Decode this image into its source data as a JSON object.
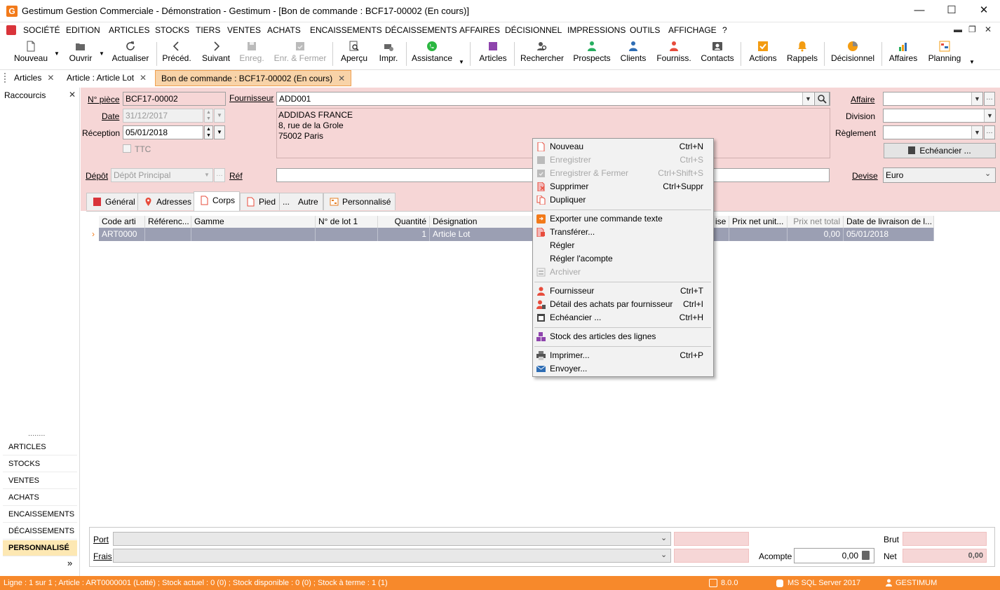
{
  "window": {
    "title": "Gestimum Gestion Commerciale - Démonstration - Gestimum - [Bon de commande : BCF17-00002 (En cours)]",
    "app_icon_letter": "G"
  },
  "menu": [
    "SOCIÉTÉ",
    "EDITION",
    "ARTICLES",
    "STOCKS",
    "TIERS",
    "VENTES",
    "ACHATS",
    "ENCAISSEMENTS",
    "DÉCAISSEMENTS",
    "AFFAIRES",
    "DÉCISIONNEL",
    "IMPRESSIONS",
    "OUTILS",
    "AFFICHAGE",
    "?"
  ],
  "toolbar": {
    "nouveau": "Nouveau",
    "ouvrir": "Ouvrir",
    "actualiser": "Actualiser",
    "preced": "Précéd.",
    "suivant": "Suivant",
    "enreg": "Enreg.",
    "enr_fermer": "Enr. & Fermer",
    "apercu": "Aperçu",
    "impr": "Impr.",
    "assistance": "Assistance",
    "articles": "Articles",
    "rechercher": "Rechercher",
    "prospects": "Prospects",
    "clients": "Clients",
    "fourniss": "Fourniss.",
    "contacts": "Contacts",
    "actions": "Actions",
    "rappels": "Rappels",
    "decisionnel": "Décisionnel",
    "affaires": "Affaires",
    "planning": "Planning"
  },
  "doc_tabs": [
    "Articles",
    "Article : Article Lot",
    "Bon de commande : BCF17-00002 (En cours)"
  ],
  "left_panel": {
    "title": "Raccourcis",
    "dots": "........",
    "items": [
      "ARTICLES",
      "STOCKS",
      "VENTES",
      "ACHATS",
      "ENCAISSEMENTS",
      "DÉCAISSEMENTS",
      "PERSONNALISÉ"
    ],
    "more": "»"
  },
  "form": {
    "npiece_label": "N° pièce",
    "npiece_value": "BCF17-00002",
    "date_label": "Date",
    "date_value": "31/12/2017",
    "reception_label": "Réception",
    "reception_value": "05/01/2018",
    "ttc_label": "TTC",
    "fournisseur_label": "Fournisseur",
    "fournisseur_value": "ADD001",
    "address": [
      "ADDIDAS FRANCE",
      "8, rue de la Grole",
      "75002 Paris"
    ],
    "affaire_label": "Affaire",
    "division_label": "Division",
    "reglement_label": "Règlement",
    "echeancier_label": "Echéancier ...",
    "depot_label": "Dépôt",
    "depot_value": "Dépôt Principal",
    "ref_label": "Réf",
    "devise_label": "Devise",
    "devise_value": "Euro"
  },
  "inner_tabs": [
    "Général",
    "Adresses",
    "Corps",
    "Pied",
    "Autre",
    "Personnalisé"
  ],
  "inner_tab_dots": "...",
  "grid": {
    "headers": [
      "Code arti",
      "Référenc...",
      "Gamme",
      "N° de lot 1",
      "Quantité",
      "Désignation",
      "ise",
      "Prix net unit...",
      "Prix net total",
      "Date de livraison de l..."
    ],
    "row": [
      "ART0000",
      "",
      "",
      "",
      "1",
      "Article Lot",
      "",
      "",
      "0,00",
      "05/01/2018"
    ],
    "row_marker": "›"
  },
  "footer": {
    "port_label": "Port",
    "frais_label": "Frais",
    "acompte_label": "Acompte",
    "acompte_value": "0,00",
    "brut_label": "Brut",
    "net_label": "Net",
    "net_value": "0,00"
  },
  "status": {
    "text": "Ligne : 1 sur 1 ; Article : ART0000001 (Lotté) ; Stock actuel : 0 (0) ; Stock disponible : 0 (0) ; Stock à terme : 1 (1)",
    "version": "8.0.0",
    "db": "MS SQL Server 2017",
    "user": "GESTIMUM"
  },
  "context_menu": [
    {
      "label": "Nouveau",
      "shortcut": "Ctrl+N",
      "enabled": true
    },
    {
      "label": "Enregistrer",
      "shortcut": "Ctrl+S",
      "enabled": false
    },
    {
      "label": "Enregistrer & Fermer",
      "shortcut": "Ctrl+Shift+S",
      "enabled": false
    },
    {
      "label": "Supprimer",
      "shortcut": "Ctrl+Suppr",
      "enabled": true
    },
    {
      "label": "Dupliquer",
      "shortcut": "",
      "enabled": true
    },
    {
      "label": "Exporter une commande texte",
      "shortcut": "",
      "enabled": true
    },
    {
      "label": "Transférer...",
      "shortcut": "",
      "enabled": true
    },
    {
      "label": "Régler",
      "shortcut": "",
      "enabled": true
    },
    {
      "label": "Régler l'acompte",
      "shortcut": "",
      "enabled": true
    },
    {
      "label": "Archiver",
      "shortcut": "",
      "enabled": false
    },
    {
      "label": "Fournisseur",
      "shortcut": "Ctrl+T",
      "enabled": true
    },
    {
      "label": "Détail des achats par fournisseur",
      "shortcut": "Ctrl+I",
      "enabled": true
    },
    {
      "label": "Echéancier ...",
      "shortcut": "Ctrl+H",
      "enabled": true
    },
    {
      "label": "Stock des articles des lignes",
      "shortcut": "",
      "enabled": true
    },
    {
      "label": "Imprimer...",
      "shortcut": "Ctrl+P",
      "enabled": true
    },
    {
      "label": "Envoyer...",
      "shortcut": "",
      "enabled": true
    }
  ],
  "colors": {
    "accent_orange": "#f7892b",
    "form_pink": "#f6d6d6",
    "grid_row": "#9b9fb3",
    "active_shortcut": "#fde8b3"
  }
}
